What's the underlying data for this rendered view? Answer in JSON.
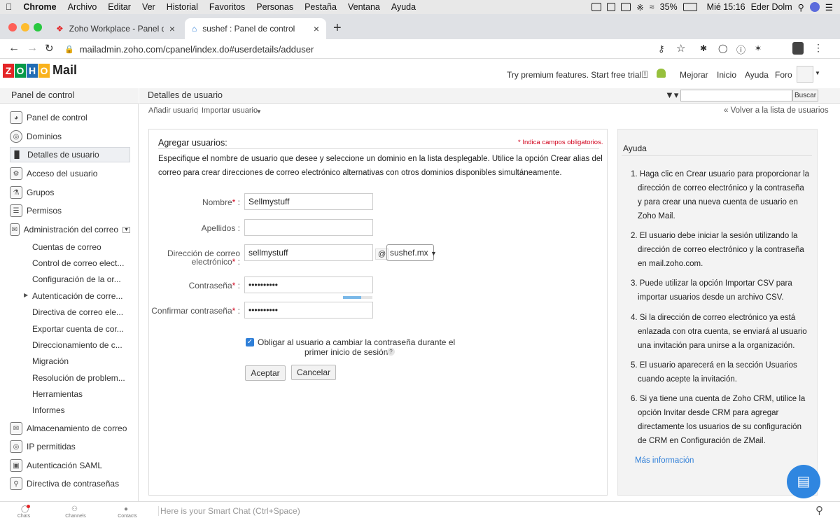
{
  "menubar": {
    "apple": "",
    "app": "Chrome",
    "items": [
      "Archivo",
      "Editar",
      "Ver",
      "Historial",
      "Favoritos",
      "Personas",
      "Pestaña",
      "Ventana",
      "Ayuda"
    ],
    "battery": "35%",
    "clock": "Mié 15:16",
    "user": "Eder Dolm"
  },
  "tabs": [
    {
      "title": "Zoho Workplace - Panel de con"
    },
    {
      "title": "sushef : Panel de control"
    }
  ],
  "address": {
    "url": "mailadmin.zoho.com/cpanel/index.do#userdetails/adduser"
  },
  "header": {
    "logo_letters": [
      "Z",
      "O",
      "H",
      "O"
    ],
    "logo_text": "Mail",
    "premium": "Try premium features. Start free trial !",
    "links": [
      "Mejorar",
      "Inicio",
      "Ayuda",
      "Foro"
    ]
  },
  "sidebar": {
    "title": "Panel de control",
    "items": [
      {
        "label": "Panel de control"
      },
      {
        "label": "Dominios"
      },
      {
        "label": "Detalles de usuario"
      },
      {
        "label": "Acceso del usuario"
      },
      {
        "label": "Grupos"
      },
      {
        "label": "Permisos"
      },
      {
        "label": "Administración del correo"
      }
    ],
    "subitems": [
      "Cuentas de correo",
      "Control de correo elect...",
      "Configuración de la or...",
      "Autenticación de corre...",
      "Directiva de correo ele...",
      "Exportar cuenta de cor...",
      "Direccionamiento de c...",
      "Migración",
      "Resolución de problem...",
      "Herramientas",
      "Informes"
    ],
    "items2": [
      {
        "label": "Almacenamiento de correo"
      },
      {
        "label": "IP permitidas"
      },
      {
        "label": "Autenticación SAML"
      },
      {
        "label": "Directiva de contraseñas"
      }
    ]
  },
  "main": {
    "title": "Detalles de usuario",
    "search_button": "Buscar",
    "add_user": "Añadir usuario",
    "import_user": "Importar usuario",
    "back_link": "« Volver a la lista de usuarios"
  },
  "form": {
    "title": "Agregar usuarios:",
    "required_note": "* Indica campos obligatorios.",
    "desc1": "Especifique el nombre de usuario que desee y seleccione un dominio en la lista desplegable. Utilice la opción Crear alias del",
    "desc2": "correo para crear direcciones de correo electrónico alternativas con otros dominios disponibles simultáneamente.",
    "first_name_label": "Nombre",
    "first_name_value": "Sellmystuff",
    "last_name_label": "Apellidos :",
    "last_name_value": "",
    "email_label1": "Dirección de correo",
    "email_label2": "electrónico",
    "email_value": "sellmystuff",
    "at": "@",
    "domain": "sushef.mx",
    "password_label": "Contraseña",
    "password_value": "••••••••••",
    "confirm_label": "Confirmar contraseña",
    "confirm_value": "••••••••••",
    "force_change_line1": "Obligar al usuario a cambiar la contraseña durante el",
    "force_change_line2": "primer inicio de sesión.",
    "help_mark": "?",
    "accept": "Aceptar",
    "cancel": "Cancelar",
    "req_mark": "*",
    "colon": ":"
  },
  "help": {
    "title": "Ayuda",
    "steps": [
      [
        "1. Haga clic en Crear usuario para proporcionar la",
        "dirección de correo electrónico y la contraseña",
        "y para crear una nueva cuenta de usuario en",
        "Zoho Mail."
      ],
      [
        "2. El usuario debe iniciar la sesión utilizando la",
        "dirección de correo electrónico y la contraseña",
        "en mail.zoho.com."
      ],
      [
        "3. Puede utilizar la opción Importar CSV para",
        "importar usuarios desde un archivo CSV."
      ],
      [
        "4. Si la dirección de correo electrónico ya está",
        "enlazada con otra cuenta, se enviará al usuario",
        "una invitación para unirse a la organización."
      ],
      [
        "5. El usuario aparecerá en la sección Usuarios",
        "cuando acepte la invitación."
      ],
      [
        "6. Si ya tiene una cuenta de Zoho CRM, utilice la",
        "opción Invitar desde CRM para agregar",
        "directamente los usuarios de su configuración",
        "de CRM en Configuración de ZMail."
      ]
    ],
    "more": "Más información"
  },
  "bottom": {
    "chats": "Chats",
    "channels": "Channels",
    "contacts": "Contacts",
    "smartchat": "Here is your Smart Chat (Ctrl+Space)"
  },
  "colors": {
    "accent": "#2f7fd8",
    "required": "#d0021b",
    "logo": [
      "#e42527",
      "#226db4",
      "#f9b21d",
      "#089949"
    ]
  }
}
